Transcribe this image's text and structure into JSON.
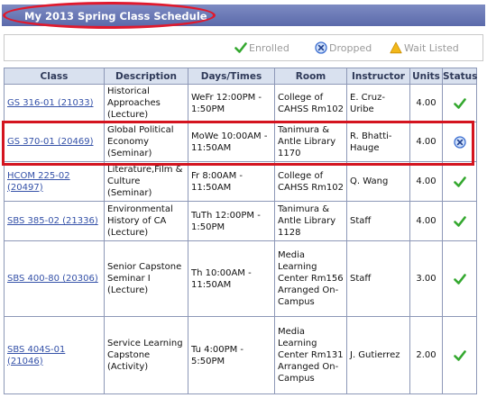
{
  "page": {
    "title": "My 2013 Spring Class Schedule",
    "colors": {
      "header_bar": "#6472b3",
      "highlight": "#d4141f",
      "enrolled": "#34a82f",
      "dropped": "#3d6fd1",
      "wait": "#f2b81a"
    }
  },
  "legend": [
    {
      "label": "Enrolled",
      "icon": "check-icon"
    },
    {
      "label": "Dropped",
      "icon": "x-circle-icon"
    },
    {
      "label": "Wait Listed",
      "icon": "warning-triangle-icon"
    }
  ],
  "table": {
    "headers": [
      "Class",
      "Description",
      "Days/Times",
      "Room",
      "Instructor",
      "Units",
      "Status"
    ],
    "rows": [
      {
        "class": "GS 316-01 (21033)",
        "description": "Historical Approaches (Lecture)",
        "days_times": "WeFr 12:00PM - 1:50PM",
        "room": "College of CAHSS Rm102",
        "instructor": "E. Cruz-Uribe",
        "units": "4.00",
        "status": "enrolled"
      },
      {
        "class": "GS 370-01 (20469)",
        "description": "Global Political Economy (Seminar)",
        "days_times": "MoWe 10:00AM - 11:50AM",
        "room": "Tanimura & Antle Library 1170",
        "instructor": "R. Bhatti-Hauge",
        "units": "4.00",
        "status": "dropped"
      },
      {
        "class": "HCOM 225-02 (20497)",
        "description": "Literature,Film & Culture (Seminar)",
        "days_times": "Fr 8:00AM - 11:50AM",
        "room": "College of CAHSS Rm102",
        "instructor": "Q. Wang",
        "units": "4.00",
        "status": "enrolled"
      },
      {
        "class": "SBS 385-02 (21336)",
        "description": "Environmental History of CA (Lecture)",
        "days_times": "TuTh 12:00PM - 1:50PM",
        "room": "Tanimura & Antle Library 1128",
        "instructor": "Staff",
        "units": "4.00",
        "status": "enrolled"
      },
      {
        "class": "SBS 400-80 (20306)",
        "description": "Senior Capstone Seminar I (Lecture)",
        "days_times": "Th 10:00AM - 11:50AM",
        "room": "Media Learning Center Rm156 Arranged On-Campus",
        "instructor": "Staff",
        "units": "3.00",
        "status": "enrolled"
      },
      {
        "class": "SBS 404S-01 (21046)",
        "description": "Service Learning Capstone (Activity)",
        "days_times": "Tu 4:00PM - 5:50PM",
        "room": "Media Learning Center Rm131 Arranged On-Campus",
        "instructor": "J. Gutierrez",
        "units": "2.00",
        "status": "enrolled"
      }
    ]
  }
}
